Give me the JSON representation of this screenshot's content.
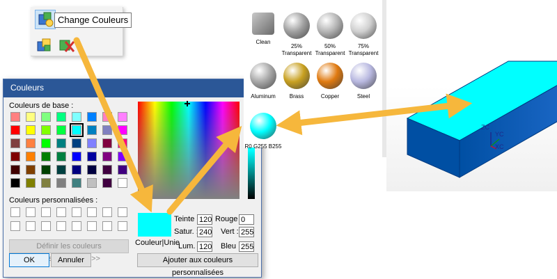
{
  "toolbar": {
    "tooltip": "Change Couleurs"
  },
  "dialog": {
    "title": "Couleurs",
    "basic_colors_label": "Couleurs de base :",
    "custom_colors_label": "Couleurs personnalisées :",
    "define_custom_button": "Définir les couleurs personnalisées >>",
    "ok_button": "OK",
    "cancel_button": "Annuler",
    "add_custom_button": "Ajouter aux couleurs personnalisées",
    "solid_color_label": "Couleur|Unie",
    "current_color": "#00ffff",
    "fields": {
      "teinte_label": "Teinte :",
      "teinte_value": "120",
      "satur_label": "Satur. :",
      "satur_value": "240",
      "lum_label": "Lum. :",
      "lum_value": "120",
      "rouge_label": "Rouge :",
      "rouge_value": "0",
      "vert_label": "Vert :",
      "vert_value": "255",
      "bleu_label": "Bleu :",
      "bleu_value": "255"
    },
    "basic_colors": [
      [
        "#ff8080",
        "#ffff80",
        "#80ff80",
        "#00ff80",
        "#80ffff",
        "#0080ff",
        "#ff80c0",
        "#ff80ff"
      ],
      [
        "#ff0000",
        "#ffff00",
        "#80ff00",
        "#00ff40",
        "#00ffff",
        "#0080c0",
        "#8080c0",
        "#ff00ff"
      ],
      [
        "#804040",
        "#ff8040",
        "#00ff00",
        "#008080",
        "#004080",
        "#8080ff",
        "#800040",
        "#ff0080"
      ],
      [
        "#800000",
        "#ff8000",
        "#008000",
        "#008040",
        "#0000ff",
        "#0000a0",
        "#800080",
        "#8000ff"
      ],
      [
        "#400000",
        "#804000",
        "#004000",
        "#004040",
        "#000080",
        "#000040",
        "#400040",
        "#400080"
      ],
      [
        "#000000",
        "#808000",
        "#808040",
        "#808080",
        "#408080",
        "#c0c0c0",
        "#400040",
        "#ffffff"
      ]
    ],
    "selected_basic": [
      1,
      4
    ]
  },
  "materials": [
    {
      "name": "Clean",
      "color": "#909090"
    },
    {
      "name": "25% Transparent",
      "color": "#a0a0a0"
    },
    {
      "name": "50% Transparent",
      "color": "#b5b5b5"
    },
    {
      "name": "75% Transparent",
      "color": "#d0d0d0"
    },
    {
      "name": "Aluminum",
      "color": "#a8a8a8"
    },
    {
      "name": "Brass",
      "color": "#c8a020"
    },
    {
      "name": "Copper",
      "color": "#e07a10"
    },
    {
      "name": "Steel",
      "color": "#b8b8e0"
    },
    {
      "name": "R0 G255 B255",
      "color": "#00ffff"
    }
  ],
  "viewport": {
    "axis_z": "ZC",
    "axis_y": "YC",
    "axis_x": "XC",
    "box_top_color": "#00ffff",
    "box_side_color": "#004fa3"
  },
  "colors": {
    "arrow": "#f6b73c",
    "title_bar": "#2b5797"
  }
}
